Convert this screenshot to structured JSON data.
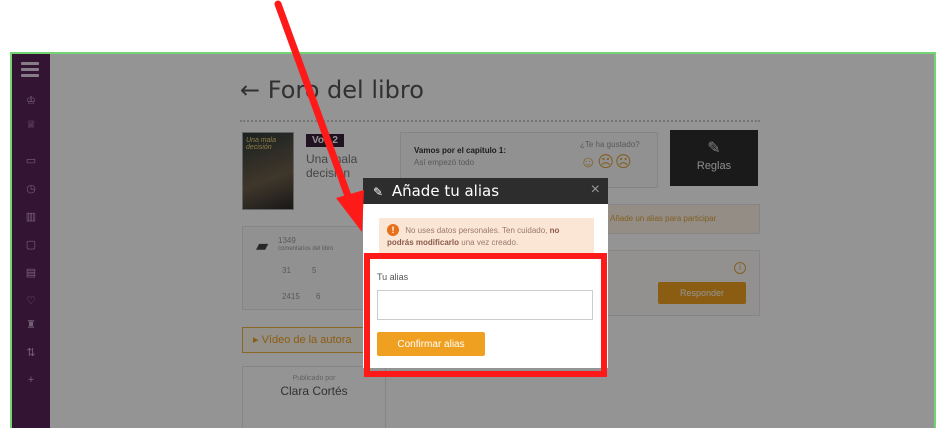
{
  "page": {
    "title": "← Foro del libro"
  },
  "book": {
    "volume_badge": "Vol. 2",
    "title": "Una mala decisión",
    "cover_text": "Una mala decisión"
  },
  "chapter": {
    "title": "Vamos por el capítulo 1:",
    "subtitle": "Así empezó todo"
  },
  "reactions": {
    "question": "¿Te ha gustado?",
    "faces": "☺☹☹"
  },
  "rules_button": {
    "label": "Reglas"
  },
  "stats": {
    "comments": "1349",
    "comments_label": "comentarios del libro",
    "likes": "31",
    "saves": "5",
    "views": "2415",
    "shares": "6"
  },
  "hints": {
    "orange_hint": "Añade un alias para participar"
  },
  "reply_button": {
    "label": "Responder"
  },
  "video_link": {
    "label": "▸ Vídeo de la autora"
  },
  "author": {
    "by": "Publicado por",
    "name": "Clara Cortés"
  },
  "modal": {
    "title": "Añade tu alias",
    "close": "×",
    "warning_prefix": "No uses datos personales. Ten cuidado,",
    "warning_bold": "no podrás modificarlo",
    "warning_suffix": "una vez creado.",
    "alias_label": "Tu alias",
    "alias_value": "",
    "alias_placeholder": "",
    "confirm_label": "Confirmar alias"
  },
  "colors": {
    "sidebar": "#5a2459",
    "accent": "#f0a020",
    "highlight": "#ff1a1a",
    "frame": "#72d572"
  },
  "icons": [
    "menu-icon",
    "pencil-icon",
    "warning-icon",
    "close-icon",
    "comment-icon",
    "rules-icon"
  ]
}
